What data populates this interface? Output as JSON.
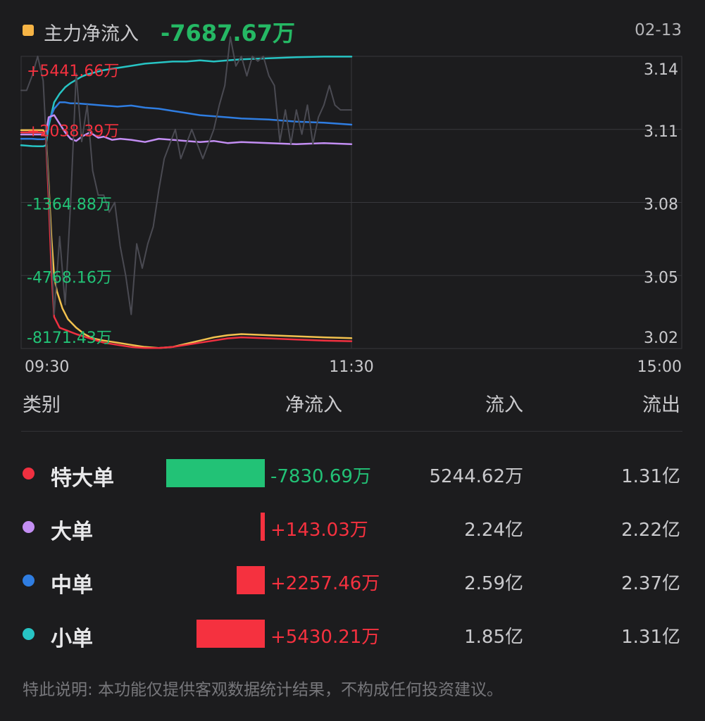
{
  "header": {
    "legend_label": "主力净流入",
    "legend_value": "-7687.67万",
    "date": "02-13",
    "legend_color": "#f6b445"
  },
  "chart_data": {
    "type": "line",
    "x_ticks": [
      "09:30",
      "11:30",
      "15:00"
    ],
    "left_axis_labels": [
      "+5441.66万",
      "+2038.39万",
      "-1364.88万",
      "-4768.16万",
      "-8171.43万"
    ],
    "left_axis_values": [
      5441.66,
      2038.39,
      -1364.88,
      -4768.16,
      -8171.43
    ],
    "right_axis_labels": [
      "3.14",
      "3.11",
      "3.08",
      "3.05",
      "3.02"
    ],
    "right_axis_values": [
      3.14,
      3.11,
      3.08,
      3.05,
      3.02
    ],
    "x_domain": [
      0,
      240
    ],
    "y_domain": [
      -8171.43,
      5441.66
    ],
    "price_domain": [
      3.02,
      3.14
    ],
    "grid": true,
    "series": [
      {
        "color": "#27c4c4",
        "x": [
          0,
          2,
          4,
          6,
          8,
          9,
          10,
          12,
          14,
          16,
          18,
          20,
          22,
          24,
          27,
          30,
          35,
          40,
          45,
          50,
          55,
          60,
          65,
          70,
          75,
          80,
          90,
          100,
          110,
          120
        ],
        "y": [
          1300,
          1280,
          1260,
          1250,
          1250,
          1300,
          2200,
          3300,
          3700,
          4000,
          4200,
          4350,
          4500,
          4600,
          4700,
          4800,
          4900,
          5000,
          5100,
          5150,
          5200,
          5200,
          5250,
          5200,
          5250,
          5300,
          5350,
          5400,
          5430,
          5430
        ]
      },
      {
        "color": "#2f7de1",
        "x": [
          0,
          2,
          4,
          6,
          8,
          9,
          10,
          12,
          14,
          16,
          18,
          20,
          25,
          30,
          35,
          40,
          45,
          50,
          55,
          60,
          65,
          70,
          75,
          80,
          90,
          100,
          110,
          120
        ],
        "y": [
          1600,
          1600,
          1600,
          1580,
          1580,
          1600,
          2400,
          3000,
          3300,
          3300,
          3250,
          3250,
          3200,
          3150,
          3100,
          3150,
          3050,
          3000,
          2900,
          2800,
          2700,
          2650,
          2600,
          2550,
          2500,
          2400,
          2350,
          2260
        ]
      },
      {
        "color": "#c38ef3",
        "x": [
          0,
          2,
          4,
          6,
          8,
          9,
          10,
          12,
          14,
          16,
          18,
          20,
          22,
          25,
          28,
          30,
          33,
          36,
          40,
          45,
          50,
          55,
          60,
          65,
          70,
          75,
          80,
          90,
          100,
          110,
          120
        ],
        "y": [
          1800,
          1800,
          1800,
          1800,
          1800,
          1850,
          2600,
          2700,
          2300,
          1900,
          1600,
          1500,
          1700,
          1900,
          1650,
          1700,
          1550,
          1600,
          1550,
          1450,
          1600,
          1550,
          1500,
          1450,
          1500,
          1400,
          1450,
          1400,
          1350,
          1400,
          1350
        ]
      },
      {
        "color": "#f2c14e",
        "x": [
          0,
          2,
          4,
          6,
          8,
          9,
          10,
          11,
          12,
          13,
          15,
          17,
          20,
          23,
          26,
          30,
          35,
          40,
          45,
          50,
          55,
          60,
          65,
          70,
          75,
          80,
          90,
          100,
          110,
          120
        ],
        "y": [
          2000,
          2000,
          2000,
          2000,
          2000,
          1800,
          -500,
          -3000,
          -4800,
          -5500,
          -6300,
          -6800,
          -7200,
          -7500,
          -7700,
          -7800,
          -7900,
          -8000,
          -8100,
          -8150,
          -8100,
          -7950,
          -7800,
          -7650,
          -7550,
          -7500,
          -7550,
          -7600,
          -7650,
          -7690
        ]
      },
      {
        "color": "#f03040",
        "x": [
          0,
          2,
          4,
          6,
          8,
          9,
          10,
          11,
          12,
          14,
          16,
          20,
          25,
          30,
          35,
          40,
          45,
          50,
          55,
          60,
          65,
          70,
          75,
          80,
          90,
          100,
          110,
          120
        ],
        "y": [
          1900,
          1900,
          1900,
          1900,
          1900,
          1700,
          -1200,
          -4500,
          -6700,
          -7200,
          -7300,
          -7500,
          -7700,
          -7900,
          -8000,
          -8100,
          -8150,
          -8150,
          -8100,
          -8000,
          -7900,
          -7800,
          -7700,
          -7650,
          -7700,
          -7750,
          -7800,
          -7830
        ]
      },
      {
        "color": "#4a4a52",
        "x": [
          0,
          2,
          4,
          6,
          8,
          10,
          12,
          14,
          16,
          18,
          20,
          22,
          24,
          26,
          28,
          30,
          32,
          34,
          36,
          38,
          40,
          42,
          44,
          46,
          48,
          50,
          52,
          54,
          56,
          58,
          60,
          62,
          64,
          66,
          68,
          70,
          72,
          74,
          76,
          78,
          80,
          82,
          84,
          86,
          88,
          90,
          92,
          94,
          96,
          98,
          100,
          102,
          104,
          106,
          108,
          110,
          112,
          114,
          116,
          118,
          120
        ],
        "y": [
          3.126,
          3.126,
          3.132,
          3.14,
          3.13,
          3.086,
          3.034,
          3.066,
          3.038,
          3.08,
          3.133,
          3.105,
          3.12,
          3.093,
          3.083,
          3.083,
          3.076,
          3.08,
          3.062,
          3.05,
          3.034,
          3.063,
          3.053,
          3.063,
          3.07,
          3.085,
          3.098,
          3.104,
          3.11,
          3.098,
          3.104,
          3.11,
          3.104,
          3.098,
          3.104,
          3.11,
          3.12,
          3.128,
          3.148,
          3.136,
          3.14,
          3.132,
          3.14,
          3.138,
          3.14,
          3.132,
          3.128,
          3.105,
          3.118,
          3.104,
          3.118,
          3.108,
          3.12,
          3.104,
          3.115,
          3.12,
          3.128,
          3.12,
          3.118,
          3.118,
          3.118
        ]
      }
    ]
  },
  "table": {
    "headers": {
      "category": "类别",
      "net": "净流入",
      "in": "流入",
      "out": "流出"
    },
    "rows": [
      {
        "label": "特大单",
        "dot_color": "#f03040",
        "net": "-7830.69万",
        "net_value": -7830.69,
        "in": "5244.62万",
        "out": "1.31亿"
      },
      {
        "label": "大单",
        "dot_color": "#c38ef3",
        "net": "+143.03万",
        "net_value": 143.03,
        "in": "2.24亿",
        "out": "2.22亿"
      },
      {
        "label": "中单",
        "dot_color": "#2f7de1",
        "net": "+2257.46万",
        "net_value": 2257.46,
        "in": "2.59亿",
        "out": "2.37亿"
      },
      {
        "label": "小单",
        "dot_color": "#27c4c4",
        "net": "+5430.21万",
        "net_value": 5430.21,
        "in": "1.85亿",
        "out": "1.31亿"
      }
    ]
  },
  "colors": {
    "positive": "#f5313f",
    "negative": "#22c276",
    "background": "#1c1c1e"
  },
  "disclaimer": "特此说明: 本功能仅提供客观数据统计结果，不构成任何投资建议。"
}
